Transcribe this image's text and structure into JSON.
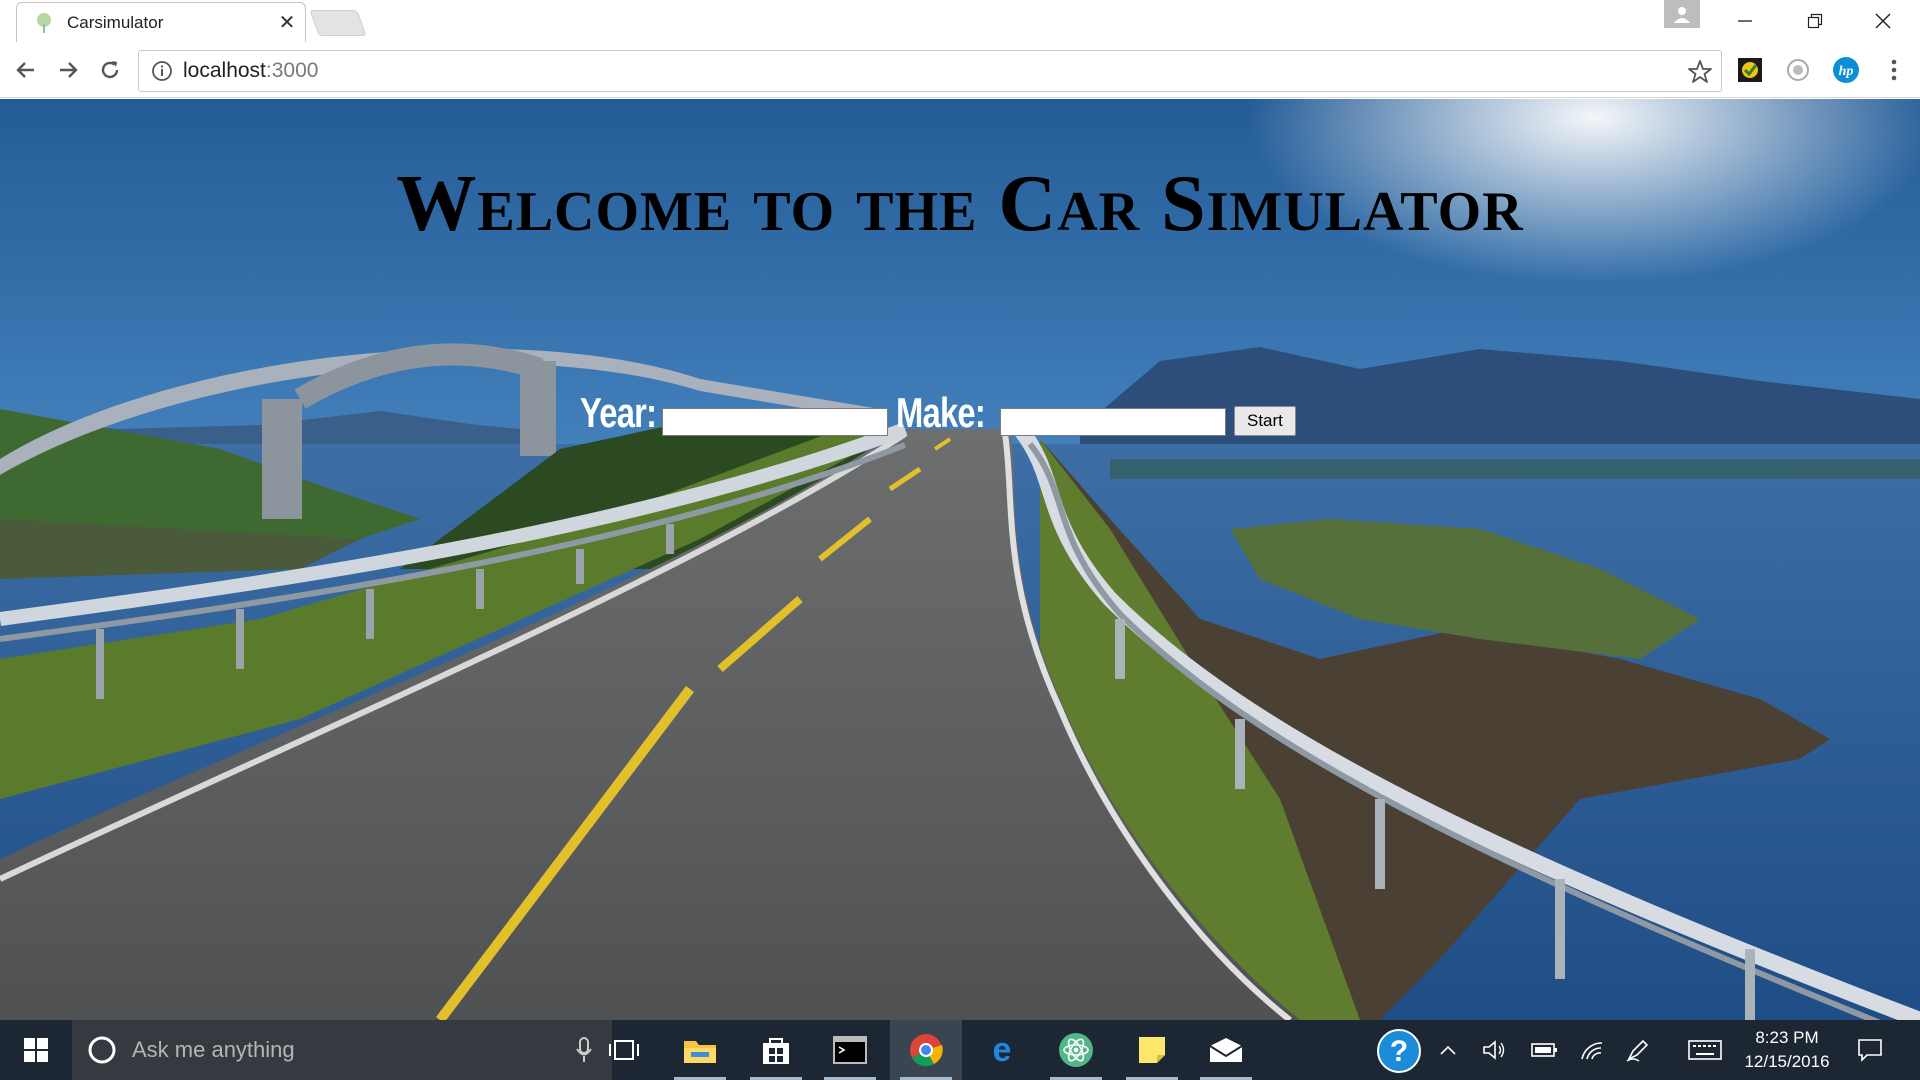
{
  "browser": {
    "tab_title": "Carsimulator",
    "close_glyph": "✕",
    "url_host": "localhost",
    "url_port": ":3000"
  },
  "page": {
    "title": "Welcome to the Car Simulator",
    "form": {
      "year_label": "Year:",
      "year_value": "",
      "make_label": "Make:",
      "make_value": "",
      "start_label": "Start"
    }
  },
  "taskbar": {
    "search_placeholder": "Ask me anything",
    "apps": [
      "task-view",
      "file-explorer",
      "store",
      "command-prompt",
      "chrome",
      "edge",
      "atom",
      "sticky-notes",
      "mail"
    ],
    "clock_time": "8:23 PM",
    "clock_date": "12/15/2016"
  },
  "colors": {
    "taskbar_bg": "#1c2733",
    "sky_top": "#2f6fae",
    "sea": "#2d5d95",
    "road": "#5e6164",
    "center_line": "#e2c02a"
  }
}
